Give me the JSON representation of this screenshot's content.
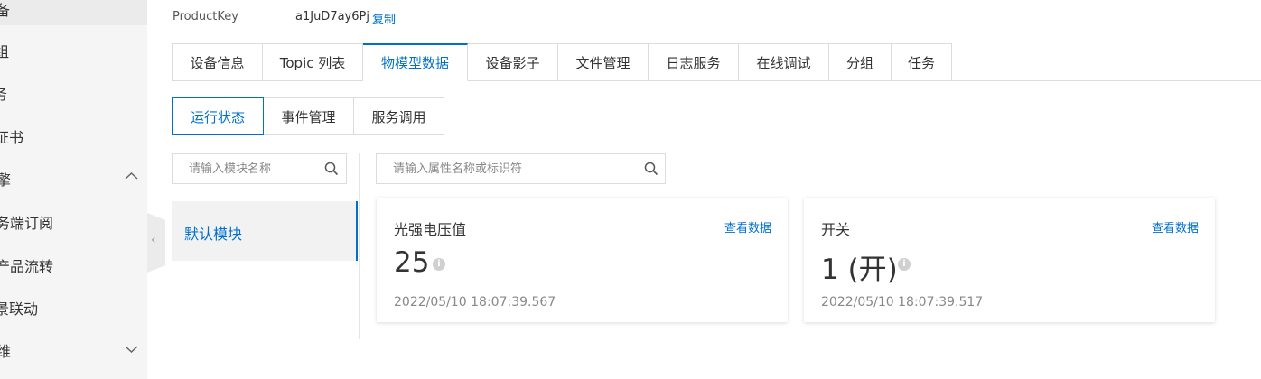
{
  "sidebar": {
    "items": [
      {
        "label": "备"
      },
      {
        "label": "组"
      },
      {
        "label": "务"
      },
      {
        "label": "证书"
      },
      {
        "label": "擎"
      },
      {
        "label": "务端订阅"
      },
      {
        "label": "产品流转"
      },
      {
        "label": "景联动"
      },
      {
        "label": "维"
      }
    ],
    "collapse_glyph": "‹"
  },
  "product": {
    "key_label": "ProductKey",
    "key_value": "a1JuD7ay6Pj",
    "copy_label": "复制"
  },
  "tabs": [
    "设备信息",
    "Topic 列表",
    "物模型数据",
    "设备影子",
    "文件管理",
    "日志服务",
    "在线调试",
    "分组",
    "任务"
  ],
  "active_tab": "物模型数据",
  "subtabs": [
    "运行状态",
    "事件管理",
    "服务调用"
  ],
  "active_subtab": "运行状态",
  "module_search": {
    "placeholder": "请输入模块名称"
  },
  "property_search": {
    "placeholder": "请输入属性名称或标识符"
  },
  "modules": [
    {
      "label": "默认模块"
    }
  ],
  "cards": [
    {
      "name": "光强电压值",
      "link": "查看数据",
      "value": "25",
      "info": "i",
      "time": "2022/05/10 18:07:39.567"
    },
    {
      "name": "开关",
      "link": "查看数据",
      "value": "1 (开)",
      "info": "i",
      "time": "2022/05/10 18:07:39.517"
    }
  ],
  "colors": {
    "accent": "#0070cc",
    "sidebar_bg": "#f5f5f5",
    "border": "#dcdcdc"
  }
}
